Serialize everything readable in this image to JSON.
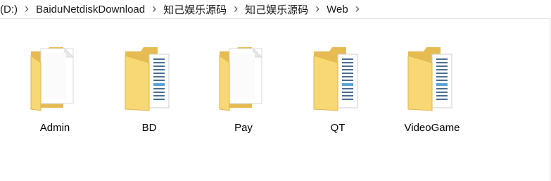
{
  "breadcrumb": {
    "items": [
      "(D:)",
      "BaiduNetdiskDownload",
      "知己娱乐源码",
      "知己娱乐源码",
      "Web"
    ]
  },
  "folders": [
    {
      "name": "Admin",
      "content": "blank-document"
    },
    {
      "name": "BD",
      "content": "document-with-text"
    },
    {
      "name": "Pay",
      "content": "blank-document"
    },
    {
      "name": "QT",
      "content": "document-with-text"
    },
    {
      "name": "VideoGame",
      "content": "document-with-text"
    }
  ],
  "colors": {
    "folder_back": "#e6bc52",
    "folder_front": "#f8d775",
    "paper": "#ffffff",
    "text_lines": "#4a6e91"
  }
}
